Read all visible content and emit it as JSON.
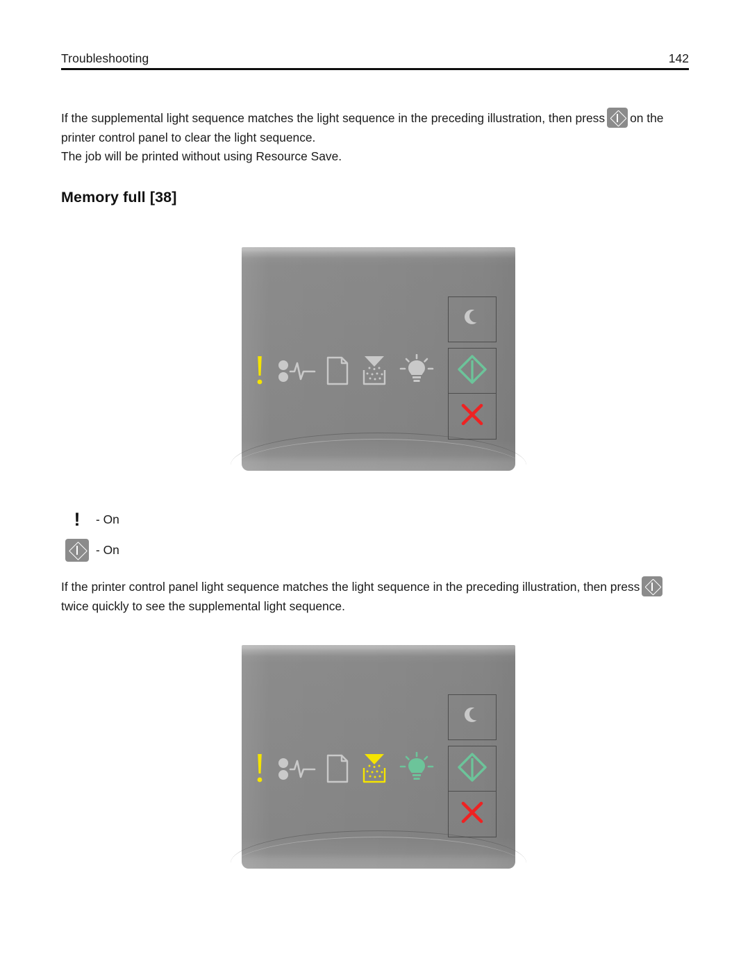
{
  "header": {
    "title": "Troubleshooting",
    "page_number": "142"
  },
  "paragraphs": {
    "intro_before_icon": "If the supplemental light sequence matches the light sequence in the preceding illustration, then press",
    "intro_after_icon": "on the printer control panel to clear the light sequence.",
    "resource_save": "The job will be printed without using Resource Save.",
    "supplemental_before_icon": "If the printer control panel light sequence matches the light sequence in the preceding illustration, then press",
    "supplemental_after_icon": "twice quickly to see the supplemental light sequence."
  },
  "heading": "Memory full [38]",
  "inline_icons": {
    "start_button": "start-button-icon"
  },
  "colors": {
    "lamp_off": "#c9c9c9",
    "lamp_amber": "#f5e400",
    "lamp_green": "#6cc49a",
    "cancel_red": "#ee2222",
    "panel_face": "#868686",
    "chip_gray": "#8b8b8b",
    "rule_black": "#0f0f0f"
  },
  "panels": [
    {
      "name": "memory-full-main-light-sequence",
      "lights": [
        {
          "name": "attention-light",
          "icon": "exclamation-icon",
          "state": "on",
          "color": "#f5e400"
        },
        {
          "name": "paper-jam-light",
          "icon": "paper-jam-icon",
          "state": "off",
          "color": "#c9c9c9"
        },
        {
          "name": "load-paper-light",
          "icon": "paper-icon",
          "state": "off",
          "color": "#c9c9c9"
        },
        {
          "name": "toner-light",
          "icon": "toner-icon",
          "state": "off",
          "color": "#c9c9c9"
        },
        {
          "name": "ready-light",
          "icon": "lightbulb-icon",
          "state": "off",
          "color": "#c9c9c9"
        }
      ],
      "buttons": [
        {
          "name": "sleep-button",
          "icon": "moon-icon",
          "state": "off",
          "color": "#c9c9c9"
        },
        {
          "name": "start-button",
          "icon": "start-diamond-icon",
          "state": "on",
          "color": "#6cc49a"
        },
        {
          "name": "cancel-button",
          "icon": "cross-icon",
          "state": "on",
          "color": "#ee2222"
        }
      ]
    },
    {
      "name": "memory-full-supplemental-light-sequence",
      "lights": [
        {
          "name": "attention-light",
          "icon": "exclamation-icon",
          "state": "on",
          "color": "#f5e400"
        },
        {
          "name": "paper-jam-light",
          "icon": "paper-jam-icon",
          "state": "off",
          "color": "#c9c9c9"
        },
        {
          "name": "load-paper-light",
          "icon": "paper-icon",
          "state": "off",
          "color": "#c9c9c9"
        },
        {
          "name": "toner-light",
          "icon": "toner-icon",
          "state": "on",
          "color": "#f5e400"
        },
        {
          "name": "ready-light",
          "icon": "lightbulb-icon",
          "state": "on",
          "color": "#6cc49a"
        }
      ],
      "buttons": [
        {
          "name": "sleep-button",
          "icon": "moon-icon",
          "state": "off",
          "color": "#c9c9c9"
        },
        {
          "name": "start-button",
          "icon": "start-diamond-icon",
          "state": "on",
          "color": "#6cc49a"
        },
        {
          "name": "cancel-button",
          "icon": "cross-icon",
          "state": "on",
          "color": "#ee2222"
        }
      ]
    }
  ],
  "legend": [
    {
      "icon": "exclamation-icon",
      "label": "- On"
    },
    {
      "icon": "start-button-icon",
      "label": "- On"
    }
  ]
}
